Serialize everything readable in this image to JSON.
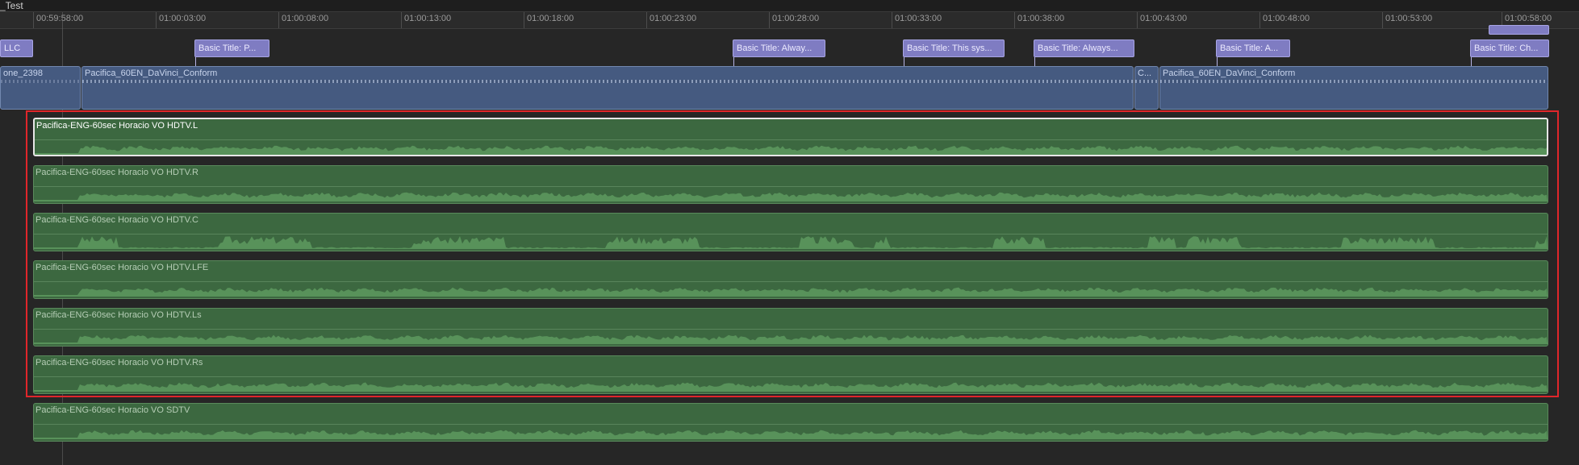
{
  "window": {
    "title_fragment": "_Test"
  },
  "ruler": {
    "labels": [
      "00:59:58:00",
      "01:00:03:00",
      "01:00:08:00",
      "01:00:13:00",
      "01:00:18:00",
      "01:00:23:00",
      "01:00:28:00",
      "01:00:33:00",
      "01:00:38:00",
      "01:00:43:00",
      "01:00:48:00",
      "01:00:53:00",
      "01:00:58:00"
    ]
  },
  "title_clips": [
    {
      "label": "LLC"
    },
    {
      "label": "Basic Title: P..."
    },
    {
      "label": "Basic Title: Alway..."
    },
    {
      "label": "Basic Title: This sys..."
    },
    {
      "label": "Basic Title: Always..."
    },
    {
      "label": "Basic Title: A..."
    },
    {
      "label": "Basic Title: Ch..."
    }
  ],
  "video_clips": [
    {
      "label": "one_2398"
    },
    {
      "label": "Pacifica_60EN_DaVinci_Conform"
    },
    {
      "label": "C..."
    },
    {
      "label": "Pacifica_60EN_DaVinci_Conform"
    }
  ],
  "audio_clips": [
    {
      "label": "Pacifica-ENG-60sec Horacio VO HDTV.L",
      "selected": true
    },
    {
      "label": "Pacifica-ENG-60sec Horacio VO HDTV.R",
      "selected": false
    },
    {
      "label": "Pacifica-ENG-60sec Horacio VO HDTV.C",
      "selected": false
    },
    {
      "label": "Pacifica-ENG-60sec Horacio VO HDTV.LFE",
      "selected": false
    },
    {
      "label": "Pacifica-ENG-60sec Horacio VO HDTV.Ls",
      "selected": false
    },
    {
      "label": "Pacifica-ENG-60sec Horacio VO HDTV.Rs",
      "selected": false
    },
    {
      "label": "Pacifica-ENG-60sec Horacio VO SDTV",
      "selected": false
    }
  ],
  "colors": {
    "audio_clip": "#3c6840",
    "video_clip": "#455a80",
    "title_clip": "#7f7cc2",
    "selection_highlight": "#e0262b"
  }
}
